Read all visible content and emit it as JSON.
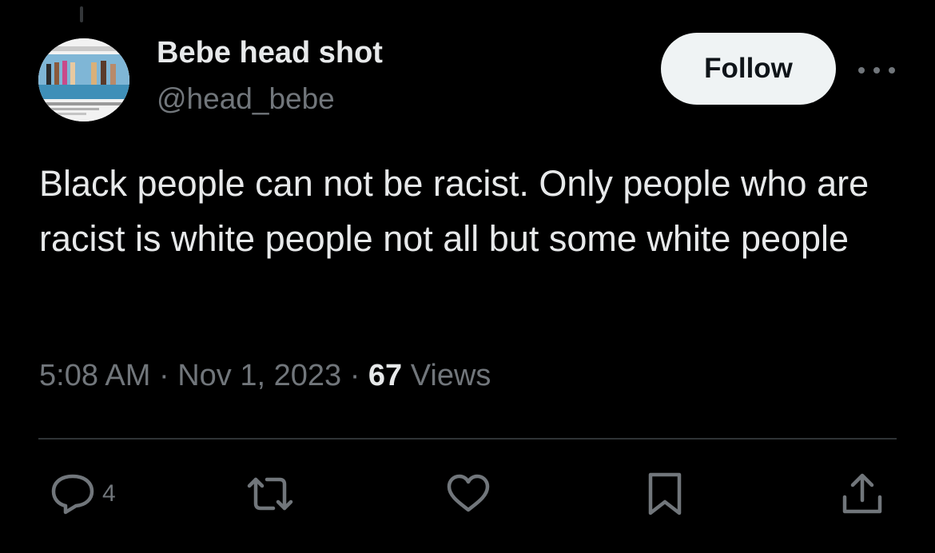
{
  "user": {
    "display_name": "Bebe head shot",
    "handle": "@head_bebe"
  },
  "header": {
    "follow_label": "Follow"
  },
  "tweet": {
    "text": "Black people can not be racist. Only people who are racist is white people not all but some white people",
    "time": "5:08 AM",
    "date": "Nov 1, 2023",
    "separator": "·",
    "views_count": "67",
    "views_label": "Views"
  },
  "actions": {
    "reply_count": "4"
  },
  "colors": {
    "background": "#000000",
    "primary_text": "#e7e9ea",
    "secondary_text": "#71767b",
    "follow_button_bg": "#eff3f4",
    "divider": "#2f3336"
  },
  "icons": [
    "reply-icon",
    "retweet-icon",
    "like-icon",
    "bookmark-icon",
    "share-icon",
    "more-icon"
  ]
}
